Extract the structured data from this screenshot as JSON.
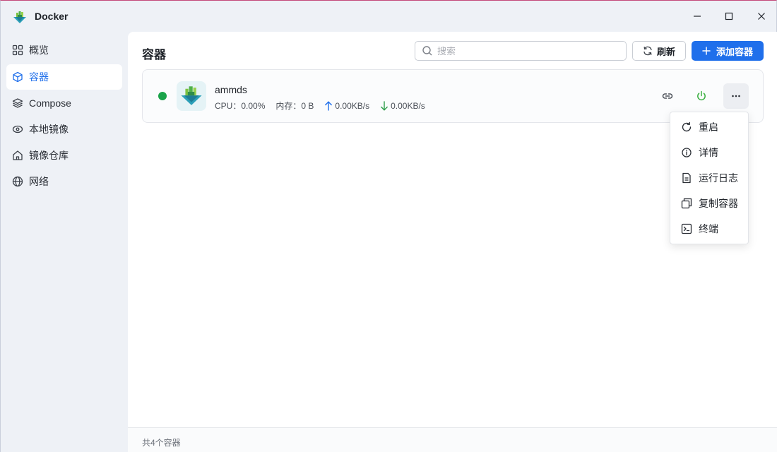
{
  "window": {
    "title": "Docker",
    "controls": [
      "minimize-icon",
      "maximize-icon",
      "close-icon"
    ]
  },
  "sidebar": {
    "items": [
      {
        "label": "概览",
        "icon": "grid-icon",
        "active": false
      },
      {
        "label": "容器",
        "icon": "cube-icon",
        "active": true
      },
      {
        "label": "Compose",
        "icon": "layers-icon",
        "active": false
      },
      {
        "label": "本地镜像",
        "icon": "disk-icon",
        "active": false
      },
      {
        "label": "镜像仓库",
        "icon": "home-icon",
        "active": false
      },
      {
        "label": "网络",
        "icon": "globe-icon",
        "active": false
      }
    ]
  },
  "header": {
    "title": "容器",
    "search_placeholder": "搜索",
    "search_value": "",
    "refresh_label": "刷新",
    "add_label": "添加容器"
  },
  "container": {
    "name": "ammds",
    "status": "running",
    "cpu_label": "CPU：",
    "cpu_value": "0.00%",
    "memory_label": "内存：",
    "memory_value": "0 B",
    "upload": "0.00KB/s",
    "download": "0.00KB/s"
  },
  "menu": {
    "items": [
      {
        "label": "重启",
        "icon": "restart-icon"
      },
      {
        "label": "详情",
        "icon": "info-icon"
      },
      {
        "label": "运行日志",
        "icon": "log-file-icon"
      },
      {
        "label": "复制容器",
        "icon": "copy-icon"
      },
      {
        "label": "终端",
        "icon": "terminal-icon"
      }
    ]
  },
  "footer": {
    "summary": "共4个容器"
  },
  "colors": {
    "accent": "#1f6feb",
    "running": "#1aa34a",
    "power": "#3cb043",
    "sidebar_bg": "#eef1f6"
  }
}
